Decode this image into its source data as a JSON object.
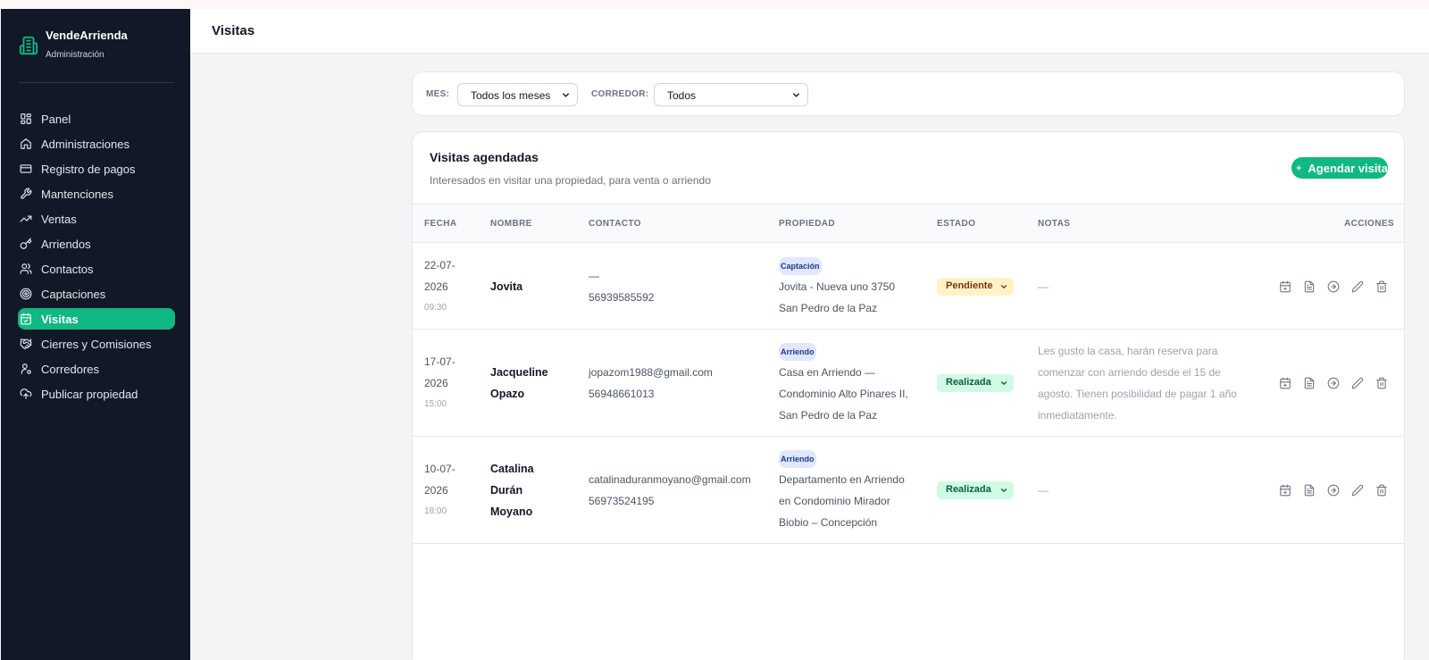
{
  "brand": {
    "name": "VendeArrienda",
    "subtitle": "Administración"
  },
  "nav": [
    {
      "label": "Panel",
      "icon": "grid-icon"
    },
    {
      "label": "Administraciones",
      "icon": "home-icon"
    },
    {
      "label": "Registro de pagos",
      "icon": "card-icon"
    },
    {
      "label": "Mantenciones",
      "icon": "wrench-icon"
    },
    {
      "label": "Ventas",
      "icon": "trending-up-icon"
    },
    {
      "label": "Arriendos",
      "icon": "key-icon"
    },
    {
      "label": "Contactos",
      "icon": "users-icon"
    },
    {
      "label": "Captaciones",
      "icon": "target-icon"
    },
    {
      "label": "Visitas",
      "icon": "calendar-check-icon",
      "active": true
    },
    {
      "label": "Cierres y Comisiones",
      "icon": "handshake-icon"
    },
    {
      "label": "Corredores",
      "icon": "user-cog-icon"
    },
    {
      "label": "Publicar propiedad",
      "icon": "upload-cloud-icon"
    }
  ],
  "header": {
    "title": "Visitas"
  },
  "filters": {
    "mes_label": "MES:",
    "mes_value": "Todos los meses",
    "corredor_label": "CORREDOR:",
    "corredor_value": "Todos"
  },
  "card": {
    "title": "Visitas agendadas",
    "subtitle": "Interesados en visitar una propiedad, para venta o arriendo",
    "add_button": "Agendar visita"
  },
  "columns": {
    "fecha": "FECHA",
    "nombre": "NOMBRE",
    "contacto": "CONTACTO",
    "propiedad": "PROPIEDAD",
    "estado": "ESTADO",
    "notas": "NOTAS",
    "acciones": "ACCIONES"
  },
  "rows": [
    {
      "date_a": "22-07-",
      "date_b": "2026",
      "time": "09:30",
      "name_lines": [
        "Jovita"
      ],
      "email": "—",
      "phone": "56939585592",
      "tag": "Captación",
      "prop_lines": [
        "Jovita - Nueva uno 3750",
        "San Pedro de la Paz"
      ],
      "status": "Pendiente",
      "status_type": "pending",
      "notes_lines": [
        "—"
      ]
    },
    {
      "date_a": "17-07-",
      "date_b": "2026",
      "time": "15:00",
      "name_lines": [
        "Jacqueline",
        "Opazo"
      ],
      "email": "jopazom1988@gmail.com",
      "phone": "56948661013",
      "tag": "Arriendo",
      "prop_lines": [
        "Casa en Arriendo —",
        "Condominio Alto Pinares II,",
        "San Pedro de la Paz"
      ],
      "status": "Realizada",
      "status_type": "done",
      "notes_lines": [
        "Les gusto la casa, harán reserva para",
        "comenzar con arriendo desde el 15 de",
        "agosto. Tienen posibilidad de pagar 1 año",
        "inmediatamente."
      ]
    },
    {
      "date_a": "10-07-",
      "date_b": "2026",
      "time": "18:00",
      "name_lines": [
        "Catalina",
        "Durán",
        "Moyano"
      ],
      "email": "catalinaduranmoyano@gmail.com",
      "phone": "56973524195",
      "tag": "Arriendo",
      "prop_lines": [
        "Departamento en Arriendo",
        "en Condominio Mirador",
        "Biobio – Concepción"
      ],
      "status": "Realizada",
      "status_type": "done",
      "notes_lines": [
        "—"
      ]
    }
  ],
  "colors": {
    "accent": "#10b981",
    "sidebar": "#111827"
  }
}
